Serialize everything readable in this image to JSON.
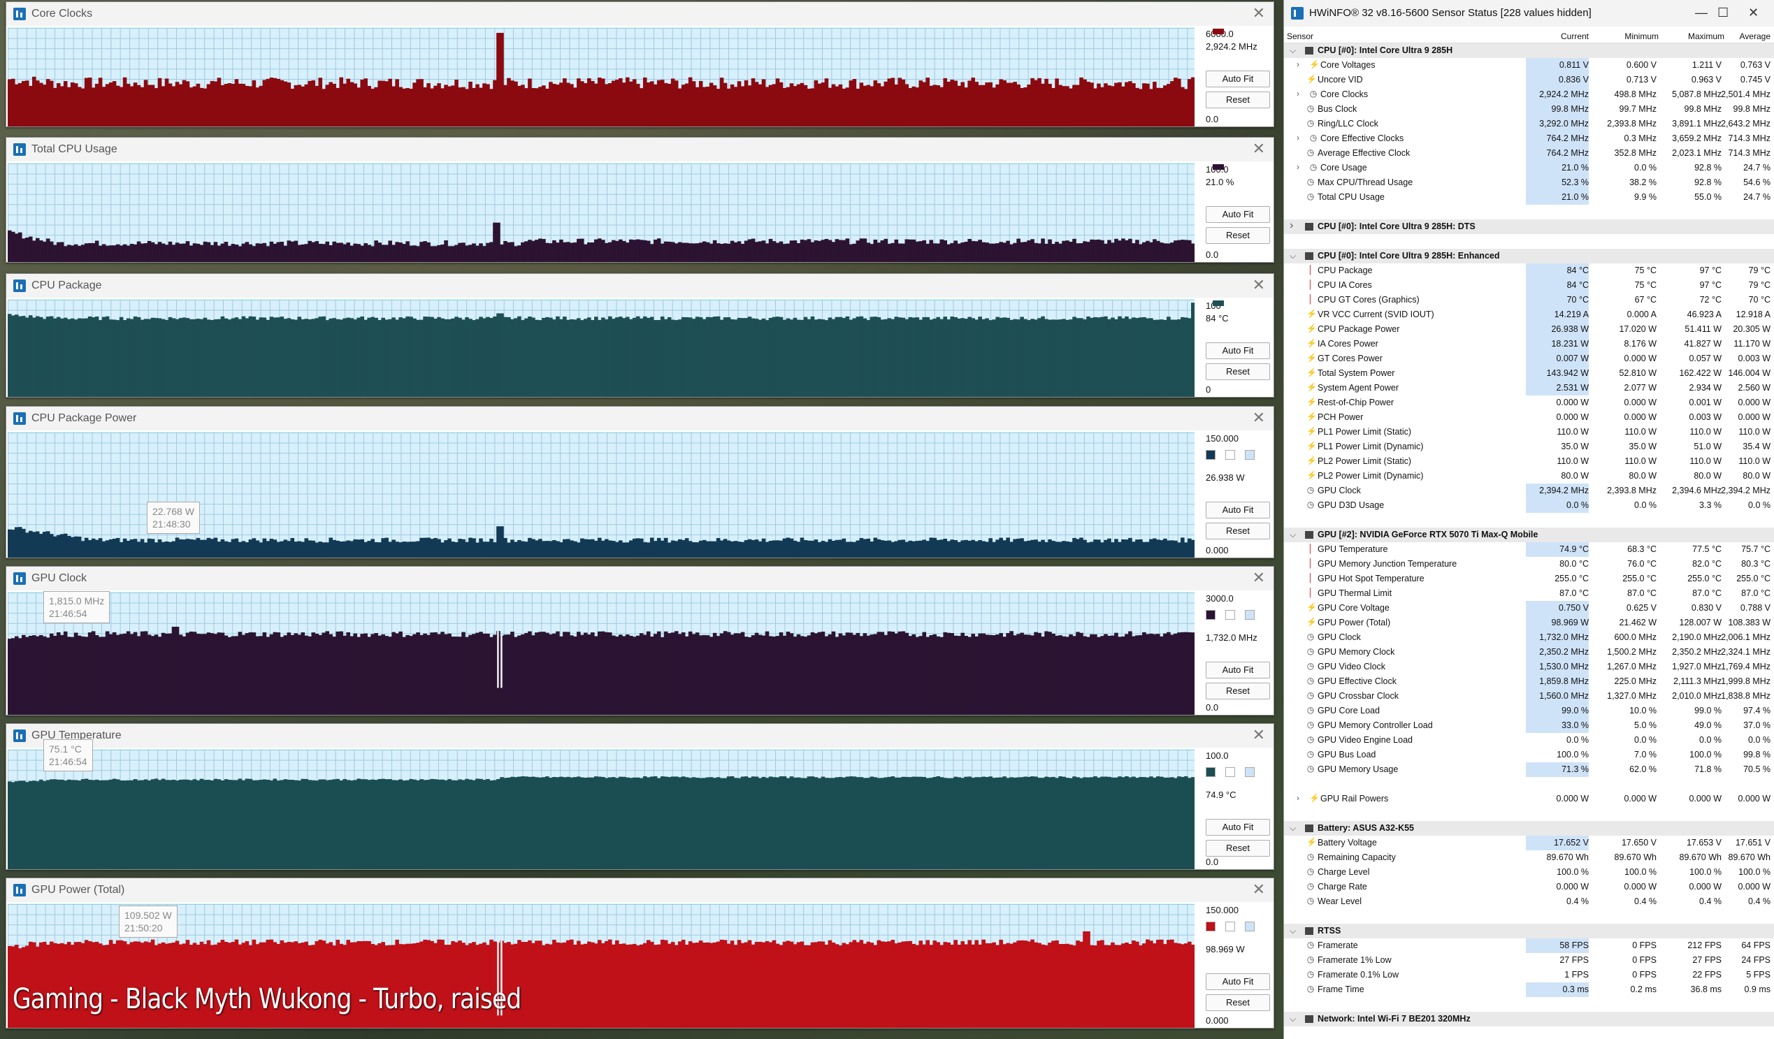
{
  "graphs": [
    {
      "title": "Core Clocks",
      "max": "6000.0",
      "current": "2,924.2 MHz",
      "min": "0.0",
      "btn_fit": "Auto Fit",
      "btn_reset": "Reset",
      "color": "#8b0a10",
      "series": {
        "start": 0.48,
        "level": 0.44,
        "noise": 0.06,
        "spikes": [
          [
            0.414,
            0.95
          ]
        ]
      }
    },
    {
      "title": "Total CPU Usage",
      "max": "100.0",
      "current": "21.0 %",
      "min": "0.0",
      "btn_fit": "Auto Fit",
      "btn_reset": "Reset",
      "color": "#2d1332",
      "series": {
        "start": 0.3,
        "level": 0.19,
        "noise": 0.03,
        "step": [
          0.43,
          0.21
        ],
        "spikes": [
          [
            0.41,
            0.4
          ]
        ]
      }
    },
    {
      "title": "CPU Package",
      "max": "100",
      "current": "84 °C",
      "min": "0",
      "btn_fit": "Auto Fit",
      "btn_reset": "Reset",
      "color": "#1e4f54",
      "series": {
        "start": 0.84,
        "level": 0.81,
        "noise": 0.02,
        "spikes": [
          [
            0.414,
            0.86
          ],
          [
            0.997,
            0.97
          ]
        ]
      }
    },
    {
      "title": "CPU Package Power",
      "max": "150.000",
      "current": "26.938 W",
      "min": "0.000",
      "btn_fit": "Auto Fit",
      "btn_reset": "Reset",
      "color": "#133a55",
      "tip": [
        "22.768 W",
        "21:48:30"
      ],
      "series": {
        "start": 0.22,
        "level": 0.14,
        "noise": 0.02,
        "decay": 0.1,
        "spikes": [
          [
            0.414,
            0.25
          ]
        ]
      }
    },
    {
      "title": "GPU Clock",
      "max": "3000.0",
      "current": "1,732.0 MHz",
      "min": "0.0",
      "btn_fit": "Auto Fit",
      "btn_reset": "Reset",
      "color": "#2b1433",
      "tip": [
        "1,815.0 MHz",
        "21:46:54"
      ],
      "series": {
        "start": 0.64,
        "level": 0.66,
        "noise": 0.025,
        "dips": [
          [
            0.414,
            0.22
          ]
        ],
        "spikes": [
          [
            0.14,
            0.72
          ]
        ]
      }
    },
    {
      "title": "GPU Temperature",
      "max": "100.0",
      "current": "74.9 °C",
      "min": "0.0",
      "btn_fit": "Auto Fit",
      "btn_reset": "Reset",
      "color": "#1b4e52",
      "tip": [
        "75.1 °C",
        "21:46:54"
      ],
      "series": {
        "start": 0.73,
        "level": 0.75,
        "noise": 0.008,
        "step": [
          0.414,
          0.77
        ]
      }
    },
    {
      "title": "GPU Power (Total)",
      "max": "150.000",
      "current": "98.969 W",
      "min": "0.000",
      "btn_fit": "Auto Fit",
      "btn_reset": "Reset",
      "color": "#c01018",
      "tip": [
        "109.502 W",
        "21:50:20"
      ],
      "series": {
        "start": 0.66,
        "level": 0.69,
        "noise": 0.025,
        "dips": [
          [
            0.414,
            0.1
          ]
        ],
        "spikes": [
          [
            0.907,
            0.78
          ]
        ]
      }
    }
  ],
  "caption": "Gaming - Black Myth Wukong - Turbo, raised",
  "hwinfo": {
    "title": "HWiNFO® 32 v8.16-5600 Sensor Status [228 values hidden]",
    "columns": {
      "sensor": "Sensor",
      "current": "Current",
      "minimum": "Minimum",
      "maximum": "Maximum",
      "average": "Average"
    },
    "rows": [
      {
        "g": "CPU [#0]: Intel Core Ultra 9 285H",
        "open": true
      },
      {
        "n": "Core Voltages",
        "i": "volt",
        "x": 1,
        "c": "0.811 V",
        "mi": "0.600 V",
        "ma": "1.211 V",
        "a": "0.763 V"
      },
      {
        "n": "Uncore VID",
        "i": "volt",
        "c": "0.836 V",
        "mi": "0.713 V",
        "ma": "0.963 V",
        "a": "0.745 V"
      },
      {
        "n": "Core Clocks",
        "i": "clk",
        "x": 1,
        "c": "2,924.2 MHz",
        "mi": "498.8 MHz",
        "ma": "5,087.8 MHz",
        "a": "2,501.4 MHz"
      },
      {
        "n": "Bus Clock",
        "i": "clk",
        "c": "99.8 MHz",
        "mi": "99.7 MHz",
        "ma": "99.8 MHz",
        "a": "99.8 MHz"
      },
      {
        "n": "Ring/LLC Clock",
        "i": "clk",
        "c": "3,292.0 MHz",
        "mi": "2,393.8 MHz",
        "ma": "3,891.1 MHz",
        "a": "2,643.2 MHz"
      },
      {
        "n": "Core Effective Clocks",
        "i": "clk",
        "x": 1,
        "c": "764.2 MHz",
        "mi": "0.3 MHz",
        "ma": "3,659.2 MHz",
        "a": "714.3 MHz"
      },
      {
        "n": "Average Effective Clock",
        "i": "clk",
        "c": "764.2 MHz",
        "mi": "352.8 MHz",
        "ma": "2,023.1 MHz",
        "a": "714.3 MHz"
      },
      {
        "n": "Core Usage",
        "i": "pct",
        "x": 1,
        "c": "21.0 %",
        "mi": "0.0 %",
        "ma": "92.8 %",
        "a": "24.7 %"
      },
      {
        "n": "Max CPU/Thread Usage",
        "i": "pct",
        "c": "52.3 %",
        "mi": "38.2 %",
        "ma": "92.8 %",
        "a": "54.6 %"
      },
      {
        "n": "Total CPU Usage",
        "i": "pct",
        "c": "21.0 %",
        "mi": "9.9 %",
        "ma": "55.0 %",
        "a": "24.7 %"
      },
      {
        "gap": true
      },
      {
        "g": "CPU [#0]: Intel Core Ultra 9 285H: DTS",
        "open": false
      },
      {
        "gap": true
      },
      {
        "g": "CPU [#0]: Intel Core Ultra 9 285H: Enhanced",
        "open": true
      },
      {
        "n": "CPU Package",
        "i": "tmp",
        "c": "84 °C",
        "mi": "75 °C",
        "ma": "97 °C",
        "a": "79 °C"
      },
      {
        "n": "CPU IA Cores",
        "i": "tmp",
        "c": "84 °C",
        "mi": "75 °C",
        "ma": "97 °C",
        "a": "79 °C"
      },
      {
        "n": "CPU GT Cores (Graphics)",
        "i": "tmp",
        "c": "70 °C",
        "mi": "67 °C",
        "ma": "72 °C",
        "a": "70 °C"
      },
      {
        "n": "VR VCC Current (SVID IOUT)",
        "i": "volt",
        "c": "14.219 A",
        "mi": "0.000 A",
        "ma": "46.923 A",
        "a": "12.918 A"
      },
      {
        "n": "CPU Package Power",
        "i": "volt",
        "c": "26.938 W",
        "mi": "17.020 W",
        "ma": "51.411 W",
        "a": "20.305 W"
      },
      {
        "n": "IA Cores Power",
        "i": "volt",
        "c": "18.231 W",
        "mi": "8.176 W",
        "ma": "41.827 W",
        "a": "11.170 W"
      },
      {
        "n": "GT Cores Power",
        "i": "volt",
        "c": "0.007 W",
        "mi": "0.000 W",
        "ma": "0.057 W",
        "a": "0.003 W"
      },
      {
        "n": "Total System Power",
        "i": "volt",
        "c": "143.942 W",
        "mi": "52.810 W",
        "ma": "162.422 W",
        "a": "146.004 W"
      },
      {
        "n": "System Agent Power",
        "i": "volt",
        "c": "2.531 W",
        "mi": "2.077 W",
        "ma": "2.934 W",
        "a": "2.560 W"
      },
      {
        "n": "Rest-of-Chip Power",
        "i": "volt",
        "c": "0.000 W",
        "mi": "0.000 W",
        "ma": "0.001 W",
        "a": "0.000 W",
        "nb": 1
      },
      {
        "n": "PCH Power",
        "i": "volt",
        "c": "0.000 W",
        "mi": "0.000 W",
        "ma": "0.003 W",
        "a": "0.000 W",
        "nb": 1
      },
      {
        "n": "PL1 Power Limit (Static)",
        "i": "volt",
        "c": "110.0 W",
        "mi": "110.0 W",
        "ma": "110.0 W",
        "a": "110.0 W",
        "nb": 1
      },
      {
        "n": "PL1 Power Limit (Dynamic)",
        "i": "volt",
        "c": "35.0 W",
        "mi": "35.0 W",
        "ma": "51.0 W",
        "a": "35.4 W",
        "nb": 1
      },
      {
        "n": "PL2 Power Limit (Static)",
        "i": "volt",
        "c": "110.0 W",
        "mi": "110.0 W",
        "ma": "110.0 W",
        "a": "110.0 W",
        "nb": 1
      },
      {
        "n": "PL2 Power Limit (Dynamic)",
        "i": "volt",
        "c": "80.0 W",
        "mi": "80.0 W",
        "ma": "80.0 W",
        "a": "80.0 W",
        "nb": 1
      },
      {
        "n": "GPU Clock",
        "i": "clk",
        "c": "2,394.2 MHz",
        "mi": "2,393.8 MHz",
        "ma": "2,394.6 MHz",
        "a": "2,394.2 MHz"
      },
      {
        "n": "GPU D3D Usage",
        "i": "pct",
        "c": "0.0 %",
        "mi": "0.0 %",
        "ma": "3.3 %",
        "a": "0.0 %"
      },
      {
        "gap": true
      },
      {
        "g": "GPU [#2]: NVIDIA  GeForce RTX 5070 Ti Max-Q Mobile",
        "open": true
      },
      {
        "n": "GPU Temperature",
        "i": "tmp",
        "c": "74.9 °C",
        "mi": "68.3 °C",
        "ma": "77.5 °C",
        "a": "75.7 °C"
      },
      {
        "n": "GPU Memory Junction Temperature",
        "i": "tmp",
        "c": "80.0 °C",
        "mi": "76.0 °C",
        "ma": "82.0 °C",
        "a": "80.3 °C",
        "nb": 1
      },
      {
        "n": "GPU Hot Spot Temperature",
        "i": "tmp",
        "c": "255.0 °C",
        "mi": "255.0 °C",
        "ma": "255.0 °C",
        "a": "255.0 °C",
        "nb": 1
      },
      {
        "n": "GPU Thermal Limit",
        "i": "tmp",
        "c": "87.0 °C",
        "mi": "87.0 °C",
        "ma": "87.0 °C",
        "a": "87.0 °C",
        "nb": 1
      },
      {
        "n": "GPU Core Voltage",
        "i": "volt",
        "c": "0.750 V",
        "mi": "0.625 V",
        "ma": "0.830 V",
        "a": "0.788 V"
      },
      {
        "n": "GPU Power (Total)",
        "i": "volt",
        "c": "98.969 W",
        "mi": "21.462 W",
        "ma": "128.007 W",
        "a": "108.383 W"
      },
      {
        "n": "GPU Clock",
        "i": "clk",
        "c": "1,732.0 MHz",
        "mi": "600.0 MHz",
        "ma": "2,190.0 MHz",
        "a": "2,006.1 MHz"
      },
      {
        "n": "GPU Memory Clock",
        "i": "clk",
        "c": "2,350.2 MHz",
        "mi": "1,500.2 MHz",
        "ma": "2,350.2 MHz",
        "a": "2,324.1 MHz"
      },
      {
        "n": "GPU Video Clock",
        "i": "clk",
        "c": "1,530.0 MHz",
        "mi": "1,267.0 MHz",
        "ma": "1,927.0 MHz",
        "a": "1,769.4 MHz"
      },
      {
        "n": "GPU Effective Clock",
        "i": "clk",
        "c": "1,859.8 MHz",
        "mi": "225.0 MHz",
        "ma": "2,111.3 MHz",
        "a": "1,999.8 MHz"
      },
      {
        "n": "GPU Crossbar Clock",
        "i": "clk",
        "c": "1,560.0 MHz",
        "mi": "1,327.0 MHz",
        "ma": "2,010.0 MHz",
        "a": "1,838.8 MHz"
      },
      {
        "n": "GPU Core Load",
        "i": "pct",
        "c": "99.0 %",
        "mi": "10.0 %",
        "ma": "99.0 %",
        "a": "97.4 %"
      },
      {
        "n": "GPU Memory Controller Load",
        "i": "pct",
        "c": "33.0 %",
        "mi": "5.0 %",
        "ma": "49.0 %",
        "a": "37.0 %"
      },
      {
        "n": "GPU Video Engine Load",
        "i": "pct",
        "c": "0.0 %",
        "mi": "0.0 %",
        "ma": "0.0 %",
        "a": "0.0 %",
        "nb": 1
      },
      {
        "n": "GPU Bus Load",
        "i": "pct",
        "c": "100.0 %",
        "mi": "7.0 %",
        "ma": "100.0 %",
        "a": "99.8 %",
        "nb": 1
      },
      {
        "n": "GPU Memory Usage",
        "i": "pct",
        "c": "71.3 %",
        "mi": "62.0 %",
        "ma": "71.8 %",
        "a": "70.5 %"
      },
      {
        "gap": true
      },
      {
        "n": "GPU Rail Powers",
        "i": "volt",
        "x": 1,
        "c": "0.000 W",
        "mi": "0.000 W",
        "ma": "0.000 W",
        "a": "0.000 W",
        "nb": 1
      },
      {
        "gap": true
      },
      {
        "g": "Battery: ASUS  A32-K55",
        "open": true
      },
      {
        "n": "Battery Voltage",
        "i": "volt",
        "c": "17.652 V",
        "mi": "17.650 V",
        "ma": "17.653 V",
        "a": "17.651 V"
      },
      {
        "n": "Remaining Capacity",
        "i": "pct",
        "c": "89.670 Wh",
        "mi": "89.670 Wh",
        "ma": "89.670 Wh",
        "a": "89.670 Wh",
        "nb": 1
      },
      {
        "n": "Charge Level",
        "i": "pct",
        "c": "100.0 %",
        "mi": "100.0 %",
        "ma": "100.0 %",
        "a": "100.0 %",
        "nb": 1
      },
      {
        "n": "Charge Rate",
        "i": "pct",
        "c": "0.000 W",
        "mi": "0.000 W",
        "ma": "0.000 W",
        "a": "0.000 W",
        "nb": 1
      },
      {
        "n": "Wear Level",
        "i": "pct",
        "c": "0.4 %",
        "mi": "0.4 %",
        "ma": "0.4 %",
        "a": "0.4 %",
        "nb": 1
      },
      {
        "gap": true
      },
      {
        "g": "RTSS",
        "open": true
      },
      {
        "n": "Framerate",
        "i": "pct",
        "c": "58 FPS",
        "mi": "0 FPS",
        "ma": "212 FPS",
        "a": "64 FPS"
      },
      {
        "n": "Framerate 1% Low",
        "i": "pct",
        "c": "27 FPS",
        "mi": "0 FPS",
        "ma": "27 FPS",
        "a": "24 FPS",
        "nb": 1
      },
      {
        "n": "Framerate 0.1% Low",
        "i": "pct",
        "c": "1 FPS",
        "mi": "0 FPS",
        "ma": "22 FPS",
        "a": "5 FPS",
        "nb": 1
      },
      {
        "n": "Frame Time",
        "i": "pct",
        "c": "0.3 ms",
        "mi": "0.2 ms",
        "ma": "36.8 ms",
        "a": "0.9 ms"
      },
      {
        "gap": true
      },
      {
        "g": "Network: Intel Wi-Fi 7 BE201 320MHz",
        "open": true
      }
    ]
  }
}
